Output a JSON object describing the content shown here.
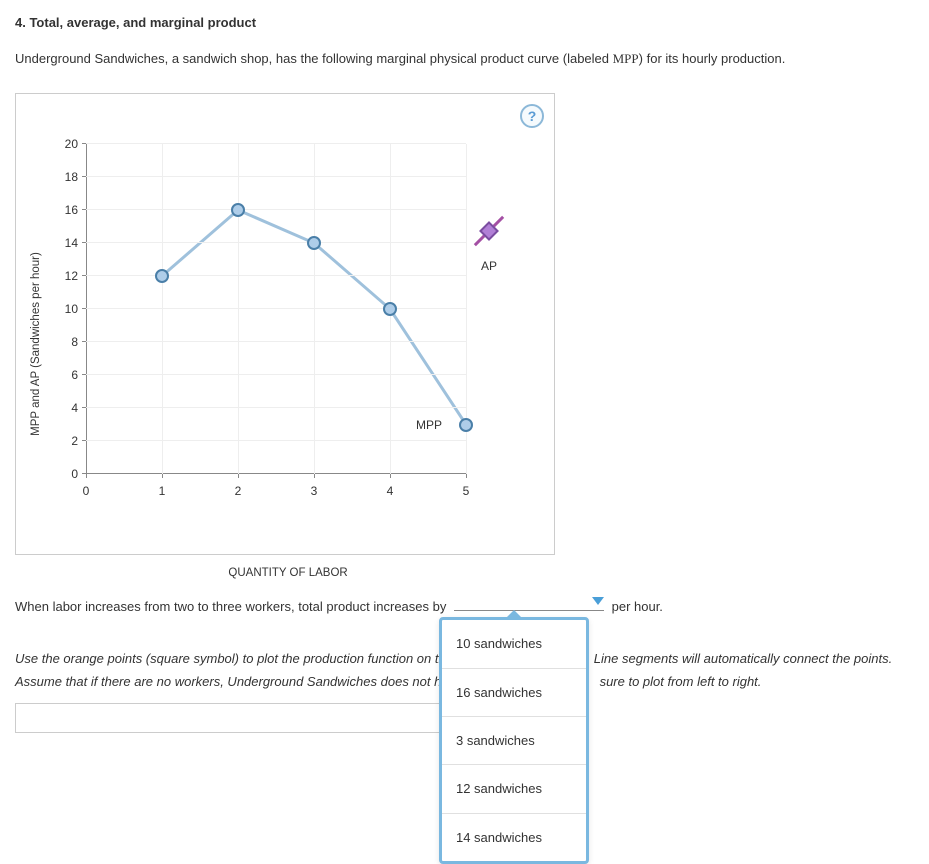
{
  "header": "4. Total, average, and marginal product",
  "intro_part1": "Underground Sandwiches, a sandwich shop, has the following marginal physical product curve (labeled ",
  "intro_mpp": "MPP",
  "intro_part2": ") for its hourly production.",
  "help_icon": "?",
  "chart_data": {
    "type": "line",
    "x": [
      1,
      2,
      3,
      4,
      5
    ],
    "values": [
      12,
      16,
      14,
      10,
      3
    ],
    "x_ticks": [
      0,
      1,
      2,
      3,
      4,
      5
    ],
    "y_ticks": [
      0,
      2,
      4,
      6,
      8,
      10,
      12,
      14,
      16,
      18,
      20
    ],
    "xlabel": "QUANTITY OF LABOR",
    "ylabel": "MPP and AP (Sandwiches per hour)",
    "series_label": "MPP",
    "xlim": [
      0,
      5
    ],
    "ylim": [
      0,
      20
    ],
    "legend": {
      "label": "AP"
    }
  },
  "question": {
    "part1": "When labor increases from two to three workers, total product increases by",
    "part2": "per hour."
  },
  "dropdown_options": [
    "10 sandwiches",
    "16 sandwiches",
    "3 sandwiches",
    "12 sandwiches",
    "14 sandwiches"
  ],
  "instruction": {
    "part1": "Use the orange points (square symbol) to plot the production function on th",
    "part2": "Line segments will automatically connect the points. Assume that if there are no workers, Underground Sandwiches does not hav",
    "part3": "sure to plot from left to right."
  }
}
